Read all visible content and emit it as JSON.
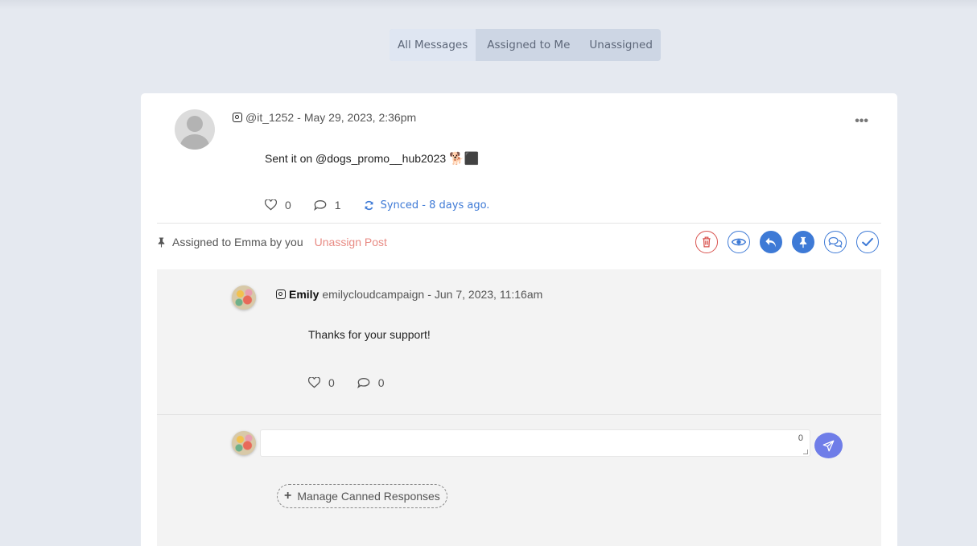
{
  "tabs": [
    {
      "label": "All Messages",
      "active": true
    },
    {
      "label": "Assigned to Me",
      "active": false
    },
    {
      "label": "Unassigned",
      "active": false
    }
  ],
  "post": {
    "platform_icon": "instagram-icon",
    "handle": "@it_1252",
    "timestamp": "May 29, 2023, 2:36pm",
    "text": "Sent it on  @dogs_promo__hub2023",
    "emoji": "🐕‍⬛",
    "likes": "0",
    "comments": "1",
    "synced": "Synced - 8 days ago.",
    "more_icon": "•••"
  },
  "assignment": {
    "text": "Assigned to Emma by you",
    "unassign_label": "Unassign Post"
  },
  "actions": [
    "trash-icon",
    "eye-icon",
    "reply-icon",
    "pin-icon",
    "comments-icon",
    "check-icon"
  ],
  "reply": {
    "name": "Emily",
    "handle": "emilycloudcampaign",
    "timestamp": "Jun 7, 2023, 11:16am",
    "text": "Thanks for your support!",
    "likes": "0",
    "comments": "0"
  },
  "compose": {
    "placeholder": "",
    "char_count": "0"
  },
  "canned": {
    "label": "Manage Canned Responses"
  },
  "colors": {
    "accent": "#3e7ad6",
    "danger": "#d9534f",
    "unassign": "#e88b84",
    "send": "#6f7de8",
    "background": "#e5e9f0"
  }
}
